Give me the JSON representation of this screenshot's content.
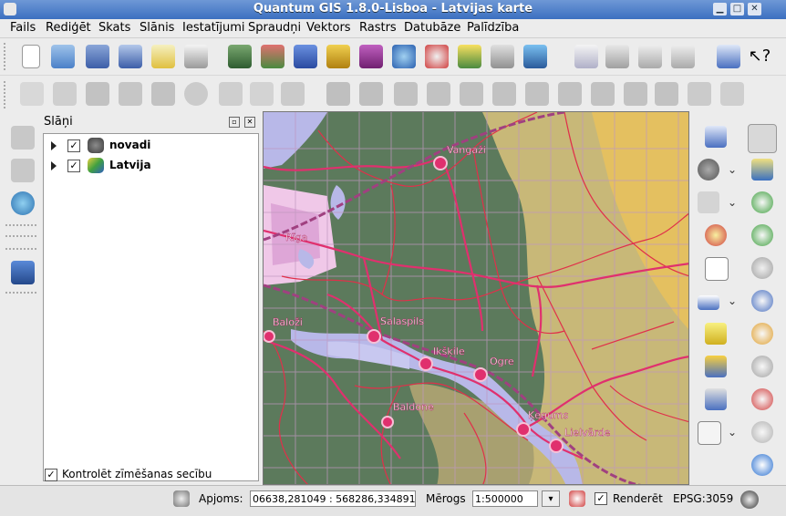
{
  "window": {
    "title": "Quantum GIS 1.8.0-Lisboa - Latvijas karte"
  },
  "menu": [
    "Fails",
    "Rediģēt",
    "Skats",
    "Slānis",
    "Iestatījumi",
    "Spraudņi",
    "Vektors",
    "Rastrs",
    "Datubāze",
    "Palīdzība"
  ],
  "layers_panel": {
    "title": "Slāņi",
    "layers": [
      {
        "name": "novadi",
        "checked": true
      },
      {
        "name": "Latvija",
        "checked": true
      }
    ],
    "render_order_label": "Kontrolēt zīmēšanas secību"
  },
  "map": {
    "places": [
      "Vangaži",
      "Rīga",
      "Baloži",
      "Salaspils",
      "Ikšķile",
      "Ogre",
      "Baldone",
      "Ķegums",
      "Lielvārde"
    ],
    "colors": {
      "forest": "#5c7a5c",
      "field": "#c8b878",
      "water": "#b8b8e8",
      "city": "#f0c8e8",
      "roads": "#e0306e",
      "borders": "#e0304a",
      "grid": "#c098c0"
    }
  },
  "status": {
    "extent_label": "Apjoms:",
    "extent_value": "06638,281049 : 568286,334891",
    "scale_label": "Mērogs",
    "scale_value": "1:500000",
    "render_label": "Renderēt",
    "render_checked": true,
    "crs": "EPSG:3059"
  },
  "icons": {
    "toolbar1": [
      "new-project-icon",
      "open-project-icon",
      "save-project-icon",
      "save-as-icon",
      "new-print-composer-icon",
      "print-icon",
      "add-vector-layer-icon",
      "add-raster-layer-icon",
      "add-postgis-layer-icon",
      "add-spatialite-layer-icon",
      "add-mssql-layer-icon",
      "add-wms-layer-icon",
      "add-wfs-layer-icon",
      "new-shapefile-icon",
      "remove-layer-icon",
      "new-spatialite-layer-icon",
      "spellcheck-icon",
      "plugin-icon",
      "plugin2-icon",
      "plugin3-icon",
      "help-icon",
      "whats-this-icon"
    ],
    "toolbar2": [
      "edit-pencil-icon",
      "save-edits-icon",
      "add-feature-icon",
      "move-feature-icon",
      "node-tool-icon",
      "delete-selected-icon",
      "cut-icon",
      "copy-icon",
      "paste-icon",
      "undo-icon",
      "redo-icon",
      "simplify-icon",
      "add-ring-icon",
      "add-part-icon",
      "delete-ring-icon",
      "delete-part-icon",
      "reshape-icon",
      "offset-curve-icon",
      "split-icon",
      "merge-features-icon",
      "merge-attributes-icon",
      "rotate-point-icon"
    ],
    "left": [
      "digitize-line-icon",
      "raster-icon",
      "globe-icon",
      "database-icon"
    ],
    "right": [
      "identify-icon",
      "pan-icon",
      "gear-icon",
      "zoom-full-icon",
      "select-icon",
      "zoom-in-icon",
      "deselect-icon",
      "zoom-out-icon",
      "attribute-table-icon",
      "zoom-selection-icon",
      "measure-icon",
      "zoom-layer-icon",
      "annotation-icon",
      "zoom-native-icon",
      "map-tip-icon",
      "zoom-last-icon",
      "new-bookmark-icon",
      "zoom-next-icon",
      "show-bookmarks-icon",
      "refresh-icon",
      "text-annotation-icon",
      "zoom-actual-icon",
      "gps-icon"
    ]
  }
}
